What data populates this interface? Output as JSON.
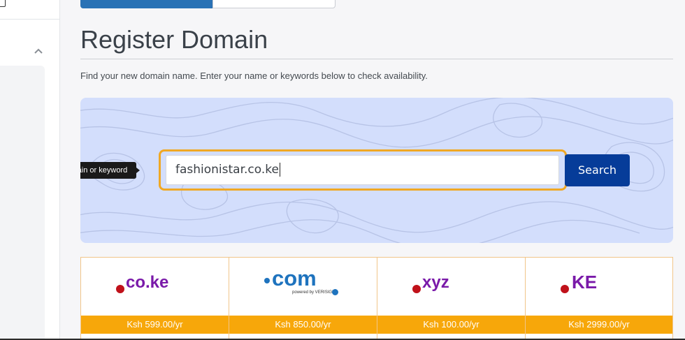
{
  "page": {
    "title": "Register Domain",
    "subtitle": "Find your new domain name. Enter your name or keywords below to check availability."
  },
  "search": {
    "value": "fashionistar.co.ke",
    "button_label": "Search",
    "tooltip": "Enter a domain or keyword"
  },
  "tlds": [
    {
      "name": ".co.ke",
      "label": "co.ke",
      "price": "Ksh 599.00/yr"
    },
    {
      "name": ".com",
      "label": "com",
      "sublabel": "powered by VERISIGN",
      "price": "Ksh 850.00/yr"
    },
    {
      "name": ".xyz",
      "label": "xyz",
      "price": "Ksh 100.00/yr"
    },
    {
      "name": ".KE",
      "label": "KE",
      "price": "Ksh 2999.00/yr"
    }
  ],
  "colors": {
    "accent": "#063c99",
    "highlight": "#f0a824",
    "price_bar": "#f7a70a",
    "hero_bg": "#d3defc",
    "tld_text": "#7a1aa9",
    "tld_dot": "#c0111a",
    "com_blue": "#1e73be"
  },
  "icons": {
    "collapse": "chevron-up-icon"
  }
}
